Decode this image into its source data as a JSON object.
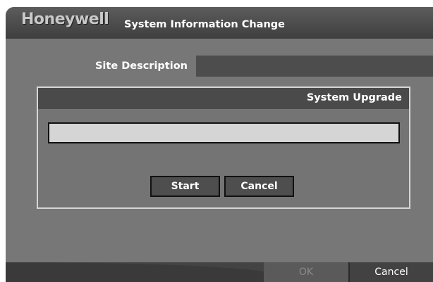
{
  "header": {
    "logo": "Honeywell",
    "title": "System Information Change"
  },
  "form": {
    "site_description_label": "Site Description",
    "site_description_value": ""
  },
  "dialog": {
    "title": "System Upgrade",
    "progress": 0,
    "start_label": "Start",
    "cancel_label": "Cancel"
  },
  "footer": {
    "ok_label": "OK",
    "cancel_label": "Cancel"
  }
}
